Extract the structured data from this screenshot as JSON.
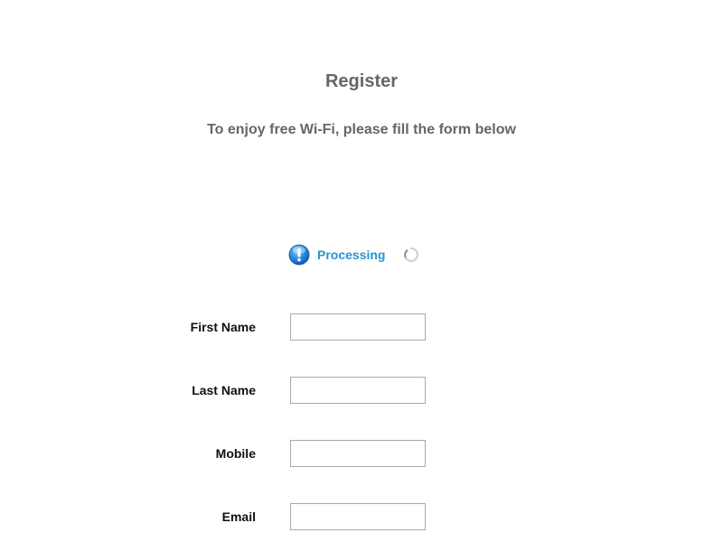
{
  "header": {
    "title": "Register",
    "subtitle": "To enjoy free Wi-Fi, please fill the form below"
  },
  "status": {
    "text": "Processing",
    "icon": "info-icon",
    "spinner_icon": "loading-spinner-icon",
    "color": "#2596d1"
  },
  "form": {
    "fields": [
      {
        "label": "First Name",
        "value": "",
        "placeholder": ""
      },
      {
        "label": "Last Name",
        "value": "",
        "placeholder": ""
      },
      {
        "label": "Mobile",
        "value": "",
        "placeholder": ""
      },
      {
        "label": "Email",
        "value": "",
        "placeholder": ""
      }
    ]
  }
}
